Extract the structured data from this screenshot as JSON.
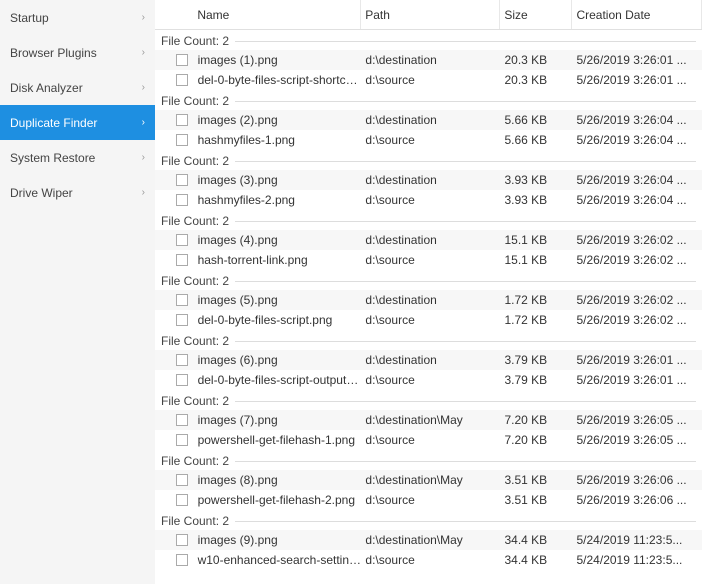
{
  "sidebar": {
    "items": [
      {
        "label": "Startup",
        "active": false
      },
      {
        "label": "Browser Plugins",
        "active": false
      },
      {
        "label": "Disk Analyzer",
        "active": false
      },
      {
        "label": "Duplicate Finder",
        "active": true
      },
      {
        "label": "System Restore",
        "active": false
      },
      {
        "label": "Drive Wiper",
        "active": false
      }
    ]
  },
  "columns": {
    "name": "Name",
    "path": "Path",
    "size": "Size",
    "date": "Creation Date"
  },
  "group_prefix": "File Count: ",
  "groups": [
    {
      "count": 2,
      "rows": [
        {
          "name": "images (1).png",
          "path": "d:\\destination",
          "size": "20.3 KB",
          "date": "5/26/2019 3:26:01 ..."
        },
        {
          "name": "del-0-byte-files-script-shortcut....",
          "path": "d:\\source",
          "size": "20.3 KB",
          "date": "5/26/2019 3:26:01 ..."
        }
      ]
    },
    {
      "count": 2,
      "rows": [
        {
          "name": "images (2).png",
          "path": "d:\\destination",
          "size": "5.66 KB",
          "date": "5/26/2019 3:26:04 ..."
        },
        {
          "name": "hashmyfiles-1.png",
          "path": "d:\\source",
          "size": "5.66 KB",
          "date": "5/26/2019 3:26:04 ..."
        }
      ]
    },
    {
      "count": 2,
      "rows": [
        {
          "name": "images (3).png",
          "path": "d:\\destination",
          "size": "3.93 KB",
          "date": "5/26/2019 3:26:04 ..."
        },
        {
          "name": "hashmyfiles-2.png",
          "path": "d:\\source",
          "size": "3.93 KB",
          "date": "5/26/2019 3:26:04 ..."
        }
      ]
    },
    {
      "count": 2,
      "rows": [
        {
          "name": "images (4).png",
          "path": "d:\\destination",
          "size": "15.1 KB",
          "date": "5/26/2019 3:26:02 ..."
        },
        {
          "name": "hash-torrent-link.png",
          "path": "d:\\source",
          "size": "15.1 KB",
          "date": "5/26/2019 3:26:02 ..."
        }
      ]
    },
    {
      "count": 2,
      "rows": [
        {
          "name": "images (5).png",
          "path": "d:\\destination",
          "size": "1.72 KB",
          "date": "5/26/2019 3:26:02 ..."
        },
        {
          "name": "del-0-byte-files-script.png",
          "path": "d:\\source",
          "size": "1.72 KB",
          "date": "5/26/2019 3:26:02 ..."
        }
      ]
    },
    {
      "count": 2,
      "rows": [
        {
          "name": "images (6).png",
          "path": "d:\\destination",
          "size": "3.79 KB",
          "date": "5/26/2019 3:26:01 ..."
        },
        {
          "name": "del-0-byte-files-script-output.png",
          "path": "d:\\source",
          "size": "3.79 KB",
          "date": "5/26/2019 3:26:01 ..."
        }
      ]
    },
    {
      "count": 2,
      "rows": [
        {
          "name": "images (7).png",
          "path": "d:\\destination\\May",
          "size": "7.20 KB",
          "date": "5/26/2019 3:26:05 ..."
        },
        {
          "name": "powershell-get-filehash-1.png",
          "path": "d:\\source",
          "size": "7.20 KB",
          "date": "5/26/2019 3:26:05 ..."
        }
      ]
    },
    {
      "count": 2,
      "rows": [
        {
          "name": "images (8).png",
          "path": "d:\\destination\\May",
          "size": "3.51 KB",
          "date": "5/26/2019 3:26:06 ..."
        },
        {
          "name": "powershell-get-filehash-2.png",
          "path": "d:\\source",
          "size": "3.51 KB",
          "date": "5/26/2019 3:26:06 ..."
        }
      ]
    },
    {
      "count": 2,
      "rows": [
        {
          "name": "images (9).png",
          "path": "d:\\destination\\May",
          "size": "34.4 KB",
          "date": "5/24/2019 11:23:5..."
        },
        {
          "name": "w10-enhanced-search-settings....",
          "path": "d:\\source",
          "size": "34.4 KB",
          "date": "5/24/2019 11:23:5..."
        }
      ]
    }
  ]
}
